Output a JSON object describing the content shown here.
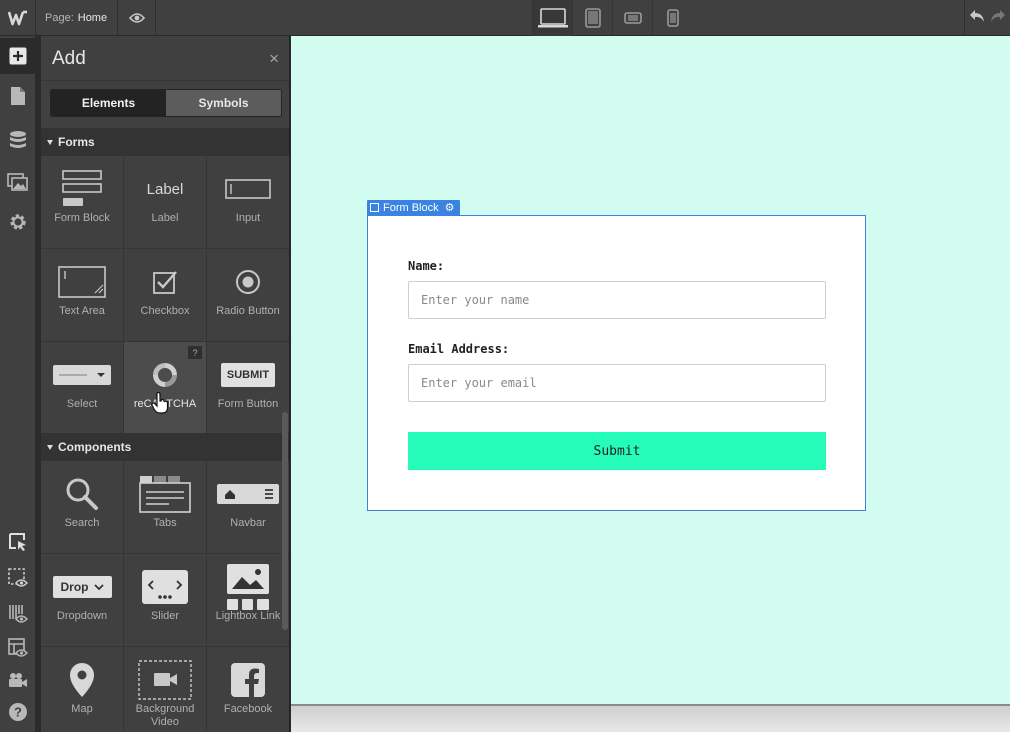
{
  "topbar": {
    "page_label": "Page:",
    "page_name": "Home",
    "devices": [
      "desktop-icon",
      "tablet-icon",
      "mobile-landscape-icon",
      "mobile-portrait-icon"
    ]
  },
  "rail": {
    "items": [
      "add-icon",
      "pages-icon",
      "cms-icon",
      "assets-icon",
      "settings-icon",
      "navigator-icon",
      "preview-select-icon",
      "style-manager-icon",
      "layout-preview-icon",
      "video-tutorials-icon",
      "help-icon"
    ]
  },
  "panel": {
    "title": "Add",
    "close": "×",
    "tabs": {
      "elements": "Elements",
      "symbols": "Symbols"
    },
    "sections": {
      "forms": "Forms",
      "components": "Components"
    },
    "forms": [
      {
        "label": "Form Block"
      },
      {
        "label": "Label",
        "icon_text": "Label"
      },
      {
        "label": "Input"
      },
      {
        "label": "Text Area"
      },
      {
        "label": "Checkbox"
      },
      {
        "label": "Radio Button"
      },
      {
        "label": "Select"
      },
      {
        "label": "reCAPTCHA",
        "badge": "?"
      },
      {
        "label": "Form Button",
        "icon_text": "SUBMIT"
      }
    ],
    "components": [
      {
        "label": "Search"
      },
      {
        "label": "Tabs"
      },
      {
        "label": "Navbar"
      },
      {
        "label": "Dropdown",
        "icon_text": "Drop"
      },
      {
        "label": "Slider"
      },
      {
        "label": "Lightbox Link"
      },
      {
        "label": "Map"
      },
      {
        "label": "Background Video"
      },
      {
        "label": "Facebook"
      }
    ]
  },
  "canvas": {
    "form_block_tag": "Form Block",
    "form": {
      "name_label": "Name:",
      "name_placeholder": "Enter your name",
      "email_label": "Email Address:",
      "email_placeholder": "Enter your email",
      "submit_label": "Submit"
    }
  },
  "colors": {
    "accent": "#3a83e0",
    "canvas_bg": "#d2fcef",
    "submit_bg": "#26fcba"
  }
}
